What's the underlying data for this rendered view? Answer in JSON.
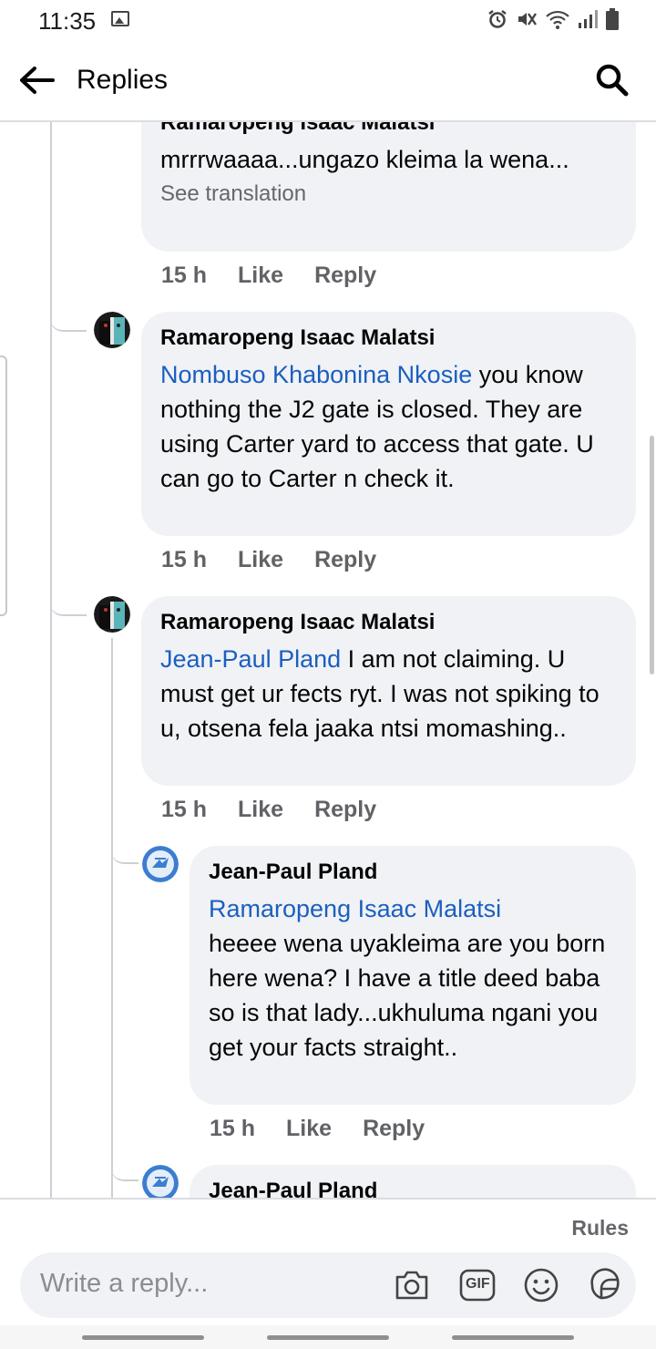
{
  "status_bar": {
    "time": "11:35",
    "icons": [
      "image-icon",
      "alarm-icon",
      "mute-icon",
      "wifi-icon",
      "signal-icon",
      "battery-icon"
    ]
  },
  "header": {
    "title": "Replies",
    "back_icon": "arrow-left-icon",
    "search_icon": "search-icon"
  },
  "comments": [
    {
      "author": "Ramaropeng Isaac Malatsi",
      "mention": "",
      "text": "mrrrwaaaa...ungazo kleima la wena...",
      "see_translation": "See translation",
      "time": "15 h",
      "like": "Like",
      "reply": "Reply"
    },
    {
      "author": "Ramaropeng Isaac Malatsi",
      "mention": "Nombuso Khabonina Nkosie",
      "text": " you know nothing the J2 gate is closed. They are using Carter yard to access that gate. U can go to Carter n check it.",
      "time": "15 h",
      "like": "Like",
      "reply": "Reply"
    },
    {
      "author": "Ramaropeng Isaac Malatsi",
      "mention": "Jean-Paul Pland",
      "text": " I am not claiming. U must get ur fects ryt. I was not spiking to u, otsena fela jaaka ntsi momashing..",
      "time": "15 h",
      "like": "Like",
      "reply": "Reply"
    },
    {
      "author": "Jean-Paul Pland",
      "mention": "Ramaropeng Isaac Malatsi",
      "text": "heeee wena uyakleima are you born here wena? I have a title deed baba so is that lady...ukhuluma ngani you get your facts straight..",
      "time": "15 h",
      "like": "Like",
      "reply": "Reply"
    },
    {
      "author": "Jean-Paul Pland"
    }
  ],
  "composer": {
    "rules": "Rules",
    "placeholder": "Write a reply...",
    "icons": [
      "camera-icon",
      "gif-icon",
      "emoji-icon",
      "sticker-icon"
    ],
    "gif_label": "GIF"
  },
  "colors": {
    "mention": "#1b5fbf",
    "bubble": "#f0f2f5",
    "secondary_text": "#65676b"
  }
}
